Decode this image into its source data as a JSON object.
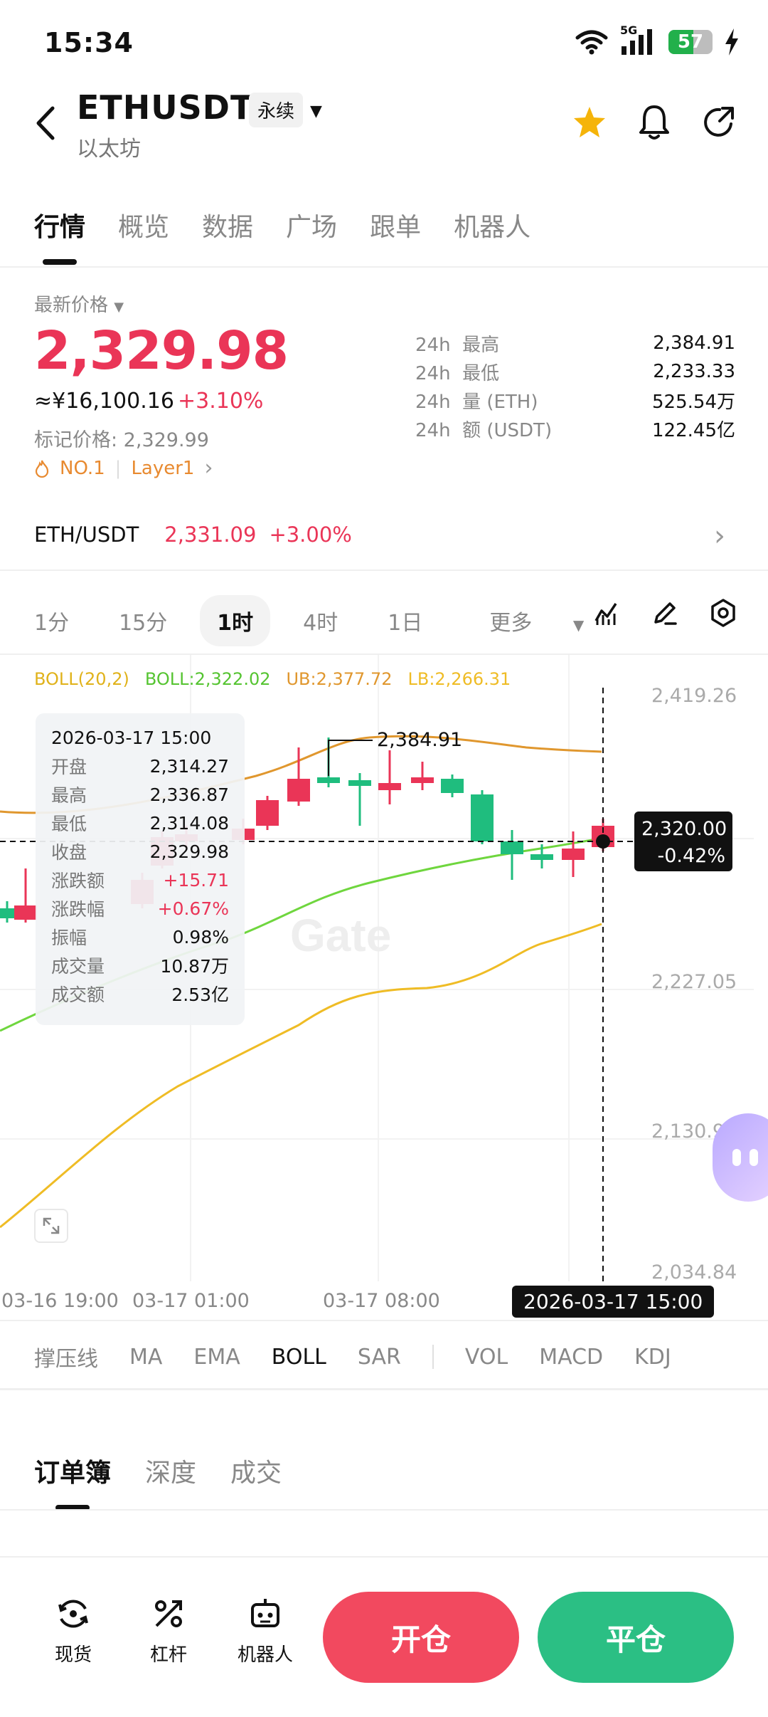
{
  "status_bar": {
    "time": "15:34",
    "network": "5G",
    "battery": "57"
  },
  "header": {
    "symbol": "ETHUSDT",
    "contract_type": "永续",
    "name": "以太坊"
  },
  "tabs": [
    {
      "label": "行情",
      "active": true
    },
    {
      "label": "概览"
    },
    {
      "label": "数据"
    },
    {
      "label": "广场"
    },
    {
      "label": "跟单"
    },
    {
      "label": "机器人"
    }
  ],
  "price_section": {
    "label": "最新价格",
    "last_price": "2,329.98",
    "cny_value": "≈¥16,100.16",
    "change_pct": "+3.10%",
    "mark_price": "标记价格: 2,329.99",
    "tag_rank": "NO.1",
    "tag_category": "Layer1",
    "stats": [
      {
        "prefix": "24h",
        "label": "最高",
        "value": "2,384.91"
      },
      {
        "prefix": "24h",
        "label": "最低",
        "value": "2,233.33"
      },
      {
        "prefix": "24h",
        "label": "量 (ETH)",
        "value": "525.54万"
      },
      {
        "prefix": "24h",
        "label": "额 (USDT)",
        "value": "122.45亿"
      }
    ]
  },
  "spot_pair": {
    "pair": "ETH/USDT",
    "price": "2,331.09",
    "change": "+3.00%"
  },
  "intervals": [
    {
      "label": "1分"
    },
    {
      "label": "15分"
    },
    {
      "label": "1时",
      "active": true
    },
    {
      "label": "4时"
    },
    {
      "label": "1日"
    },
    {
      "label": "更多"
    }
  ],
  "boll_legend": {
    "name": "BOLL(20,2)",
    "mid": "BOLL:2,322.02",
    "ub": "UB:2,377.72",
    "lb": "LB:2,266.31"
  },
  "colors": {
    "up": "#ea3557",
    "down": "#1fbd7e",
    "boll": "#e0972e",
    "mid": "#6fd63e",
    "lb": "#efbc25"
  },
  "chart_data": {
    "type": "candlestick",
    "y_ticks": [
      "2,419.26",
      "2,227.05",
      "2,130.95",
      "2,034.84"
    ],
    "x_ticks": [
      "03-16 19:00",
      "03-17 01:00",
      "03-17 08:00"
    ],
    "crosshair_price": "2,320.00",
    "crosshair_change": "-0.42%",
    "crosshair_time": "2026-03-17 15:00",
    "high_marker": "2,384.91",
    "watermark": "Gate",
    "tooltip": {
      "time": "2026-03-17 15:00",
      "rows": [
        {
          "label": "开盘",
          "value": "2,314.27"
        },
        {
          "label": "最高",
          "value": "2,336.87"
        },
        {
          "label": "最低",
          "value": "2,314.08"
        },
        {
          "label": "收盘",
          "value": "2,329.98"
        },
        {
          "label": "涨跌额",
          "value": "+15.71",
          "up": true
        },
        {
          "label": "涨跌幅",
          "value": "+0.67%",
          "up": true
        },
        {
          "label": "振幅",
          "value": "0.98%"
        },
        {
          "label": "成交量",
          "value": "10.87万"
        },
        {
          "label": "成交额",
          "value": "2.53亿"
        }
      ]
    }
  },
  "indicators": [
    "撑压线",
    "MA",
    "EMA",
    "BOLL",
    "SAR",
    "VOL",
    "MACD",
    "KDJ"
  ],
  "orderbook_tabs": [
    "订单簿",
    "深度",
    "成交"
  ],
  "bottom_nav": [
    {
      "label": "现货",
      "icon": "spot-icon"
    },
    {
      "label": "杠杆",
      "icon": "leverage-icon"
    },
    {
      "label": "机器人",
      "icon": "robot-icon"
    }
  ],
  "actions": {
    "open": "开仓",
    "close": "平仓"
  }
}
